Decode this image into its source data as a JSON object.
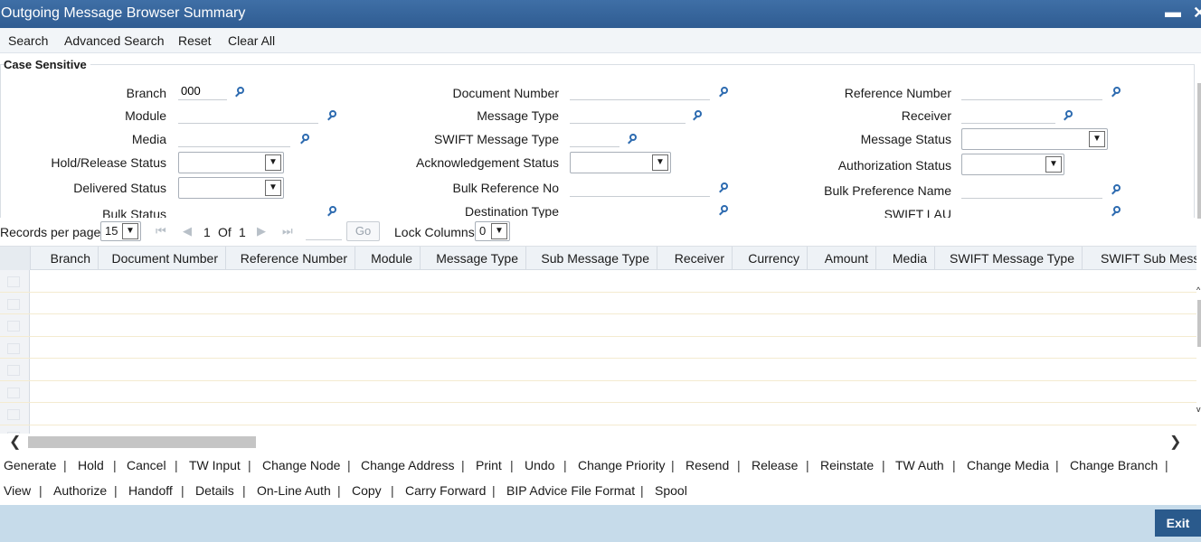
{
  "window": {
    "title": "Outgoing Message Browser Summary",
    "minimize": "▬",
    "close": "✕"
  },
  "toolbar": {
    "search": "Search",
    "advanced_search": "Advanced Search",
    "reset": "Reset",
    "clear_all": "Clear All"
  },
  "form": {
    "legend": "Case Sensitive",
    "labels": {
      "branch": "Branch",
      "module": "Module",
      "media": "Media",
      "hold_release_status": "Hold/Release Status",
      "delivered_status": "Delivered Status",
      "bulk_status": "Bulk Status",
      "document_number": "Document Number",
      "message_type": "Message Type",
      "swift_message_type": "SWIFT Message Type",
      "acknowledgement_status": "Acknowledgement Status",
      "bulk_reference_no": "Bulk Reference No",
      "destination_type": "Destination Type",
      "reference_number": "Reference Number",
      "receiver": "Receiver",
      "message_status": "Message Status",
      "authorization_status": "Authorization Status",
      "bulk_preference_name": "Bulk Preference Name",
      "swift_lau": "SWIFT LAU"
    },
    "values": {
      "branch": "000"
    }
  },
  "pager": {
    "records_per_page_label": "Records per page",
    "records_per_page": "15",
    "current_page": "1",
    "of_label": "Of",
    "total_pages": "1",
    "go_label": "Go",
    "lock_columns_label": "Lock Columns",
    "lock_columns": "0"
  },
  "grid": {
    "columns": [
      "Branch",
      "Document Number",
      "Reference Number",
      "Module",
      "Message Type",
      "Sub Message Type",
      "Receiver",
      "Currency",
      "Amount",
      "Media",
      "SWIFT Message Type",
      "SWIFT Sub Mess"
    ]
  },
  "actions": {
    "row1": [
      "Generate",
      "Hold",
      "Cancel",
      "TW Input",
      "Change Node",
      "Change Address",
      "Print",
      "Undo",
      "Change Priority",
      "Resend",
      "Release",
      "Reinstate",
      "TW Auth",
      "Change Media",
      "Change Branch"
    ],
    "row2": [
      "View",
      "Authorize",
      "Handoff",
      "Details",
      "On-Line Auth",
      "Copy",
      "Carry Forward",
      "BIP Advice File Format",
      "Spool"
    ]
  },
  "footer": {
    "exit_label": "Exit"
  },
  "colors": {
    "titlebar": "#2f5c92",
    "footer": "#c6dbea",
    "exit_button": "#2a5a8c",
    "search_icon": "#2d6bb0"
  }
}
